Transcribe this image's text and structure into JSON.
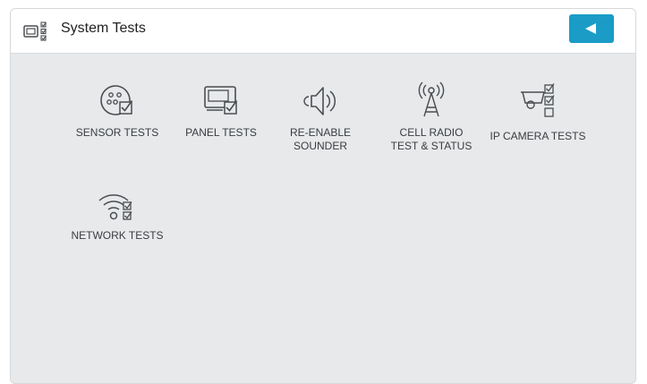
{
  "header": {
    "title": "System Tests",
    "icon": "test-checklist-icon",
    "back_button_icon": "back-arrow-icon"
  },
  "colors": {
    "accent": "#1a9cc6",
    "background": "#e7e9eb",
    "icon": "#4a4d51"
  },
  "tiles": [
    {
      "label": "SENSOR TESTS",
      "icon": "sensor-test-icon"
    },
    {
      "label": "PANEL TESTS",
      "icon": "panel-test-icon"
    },
    {
      "label": "RE-ENABLE\nSOUNDER",
      "icon": "speaker-icon"
    },
    {
      "label": "CELL RADIO\nTEST & STATUS",
      "icon": "cell-tower-icon"
    },
    {
      "label": "IP CAMERA TESTS",
      "icon": "ip-camera-test-icon"
    },
    {
      "label": "NETWORK TESTS",
      "icon": "wifi-test-icon"
    }
  ]
}
